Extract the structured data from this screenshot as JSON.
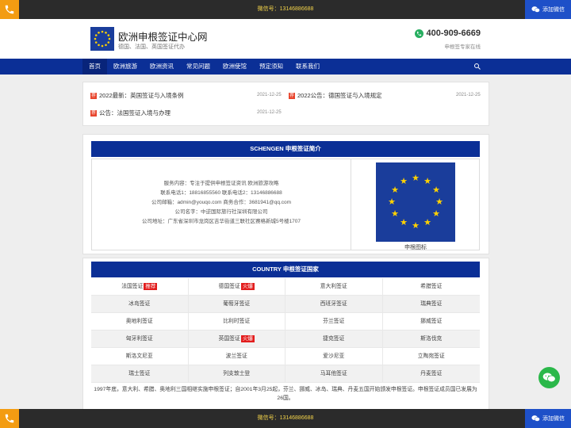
{
  "topbar": {
    "wechat_text": "微信号：13146886688",
    "add_wechat": "添加微信"
  },
  "header": {
    "title": "欧洲申根签证中心网",
    "subtitle": "德国、法国、英国签证代办",
    "phone": "400-909-6669",
    "slogan": "申根签专家在线"
  },
  "nav": {
    "items": [
      "首页",
      "欧洲旅游",
      "欧洲资讯",
      "常见问题",
      "欧洲使馆",
      "预定须知",
      "联系我们"
    ]
  },
  "news": [
    {
      "tag": "荐",
      "title": "2022最新：英国签证与入境条例",
      "date": "2021-12-25"
    },
    {
      "tag": "荐",
      "title": "2022公告：德国签证与入境规定",
      "date": "2021-12-25"
    },
    {
      "tag": "荐",
      "title": "公告：法国签证入境与办理",
      "date": "2021-12-25"
    }
  ],
  "intro": {
    "heading": "SCHENGEN 申根签证简介",
    "lines": [
      "服务内容：专注于提供申根签证资讯 欧洲旅游攻略",
      "联系电话1：18816855560 联系电话2：13146886688",
      "公司邮箱：admin@youqo.com 商务合作：3681941@qq.com",
      "公司名字：中逆国际旅行社深圳有限公司",
      "公司地址：广东省深圳市龙岗区吉华街道三联社区赛格新城5号楼1707"
    ],
    "flag_caption": "申根图标"
  },
  "country": {
    "heading": "COUNTRY 申根签证国家",
    "rows": [
      [
        {
          "name": "法国签证",
          "badge": "推荐"
        },
        {
          "name": "德国签证",
          "badge": "火爆"
        },
        {
          "name": "意大利签证",
          "badge": ""
        },
        {
          "name": "希腊签证",
          "badge": ""
        }
      ],
      [
        {
          "name": "冰岛签证",
          "badge": ""
        },
        {
          "name": "葡萄牙签证",
          "badge": ""
        },
        {
          "name": "西班牙签证",
          "badge": ""
        },
        {
          "name": "瑞典签证",
          "badge": ""
        }
      ],
      [
        {
          "name": "奥地利签证",
          "badge": ""
        },
        {
          "name": "比利时签证",
          "badge": ""
        },
        {
          "name": "芬兰签证",
          "badge": ""
        },
        {
          "name": "挪威签证",
          "badge": ""
        }
      ],
      [
        {
          "name": "匈牙利签证",
          "badge": ""
        },
        {
          "name": "英国签证",
          "badge": "火爆"
        },
        {
          "name": "捷克签证",
          "badge": ""
        },
        {
          "name": "斯洛伐克",
          "badge": ""
        }
      ],
      [
        {
          "name": "斯洛文尼亚",
          "badge": ""
        },
        {
          "name": "波兰签证",
          "badge": ""
        },
        {
          "name": "爱沙尼亚",
          "badge": ""
        },
        {
          "name": "立陶宛签证",
          "badge": ""
        }
      ],
      [
        {
          "name": "瑞士签证",
          "badge": ""
        },
        {
          "name": "列支敦士登",
          "badge": ""
        },
        {
          "name": "马耳他签证",
          "badge": ""
        },
        {
          "name": "丹麦签证",
          "badge": ""
        }
      ]
    ],
    "note": "1997年底，意大利、希腊、奥地利三国相继实施申根签证；自2001年3月25起，芬兰、挪威、冰岛、瑞典、丹麦五国开始颁发申根签证。申根签证成员国已发展为26国。"
  },
  "colors": {
    "nav_blue": "#0b2f96",
    "accent_orange": "#f39c12",
    "wechat_green": "#2bb84a",
    "badge_red": "#e21d1d"
  }
}
